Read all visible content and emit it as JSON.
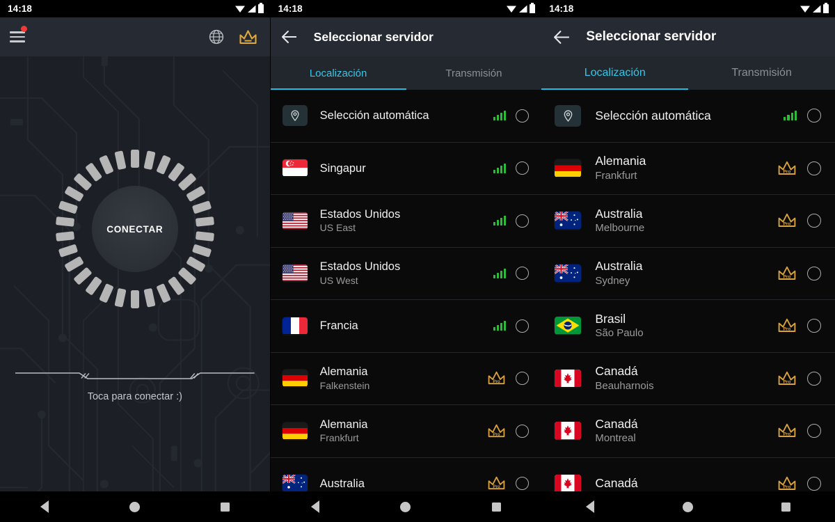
{
  "meta": {
    "accent_cyan": "#19c0e3",
    "accent_gold": "#e0a93b",
    "signal_green": "#2fbb3a",
    "alert_red": "#f03b35"
  },
  "status_bar": {
    "time": "14:18",
    "wifi_icon": "wifi-icon",
    "signal_icon": "cell-signal-icon",
    "battery_icon": "battery-icon"
  },
  "nav_bar": {
    "back": "back-triangle-icon",
    "home": "home-circle-icon",
    "recents": "recents-square-icon"
  },
  "panel_home": {
    "toolbar": {
      "menu_icon": "hamburger-menu-icon",
      "badge": "notification-dot",
      "globe_icon": "globe-icon",
      "crown_icon": "crown-icon"
    },
    "connect_button": {
      "label": "CONECTAR"
    },
    "hint": "Toca para conectar :)"
  },
  "panel_servers_narrow": {
    "toolbar": {
      "back_icon": "back-arrow-icon",
      "title": "Seleccionar servidor"
    },
    "tabs": [
      {
        "label": "Localización",
        "active": true
      },
      {
        "label": "Transmisión",
        "active": false
      }
    ],
    "rows": [
      {
        "country": "Selección automática",
        "city": "",
        "flag": "auto-location-pin",
        "badge": "signal",
        "selected": false
      },
      {
        "country": "Singapur",
        "city": "",
        "flag": "sg",
        "badge": "signal",
        "selected": false
      },
      {
        "country": "Estados Unidos",
        "city": "US East",
        "flag": "us",
        "badge": "signal",
        "selected": false
      },
      {
        "country": "Estados Unidos",
        "city": "US West",
        "flag": "us",
        "badge": "signal",
        "selected": false
      },
      {
        "country": "Francia",
        "city": "",
        "flag": "fr",
        "badge": "signal",
        "selected": false
      },
      {
        "country": "Alemania",
        "city": "Falkenstein",
        "flag": "de",
        "badge": "pro",
        "selected": false
      },
      {
        "country": "Alemania",
        "city": "Frankfurt",
        "flag": "de",
        "badge": "pro",
        "selected": false
      },
      {
        "country": "Australia",
        "city": "",
        "flag": "au",
        "badge": "pro",
        "selected": false
      }
    ]
  },
  "panel_servers_wide": {
    "toolbar": {
      "back_icon": "back-arrow-icon",
      "title": "Seleccionar servidor"
    },
    "tabs": [
      {
        "label": "Localización",
        "active": true
      },
      {
        "label": "Transmisión",
        "active": false
      }
    ],
    "rows": [
      {
        "country": "Selección automática",
        "city": "",
        "flag": "auto-location-pin",
        "badge": "signal",
        "selected": false
      },
      {
        "country": "Alemania",
        "city": "Frankfurt",
        "flag": "de",
        "badge": "pro",
        "selected": false
      },
      {
        "country": "Australia",
        "city": "Melbourne",
        "flag": "au",
        "badge": "pro",
        "selected": false
      },
      {
        "country": "Australia",
        "city": "Sydney",
        "flag": "au",
        "badge": "pro",
        "selected": false
      },
      {
        "country": "Brasil",
        "city": "São Paulo",
        "flag": "br",
        "badge": "pro",
        "selected": false
      },
      {
        "country": "Canadá",
        "city": "Beauharnois",
        "flag": "ca",
        "badge": "pro",
        "selected": false
      },
      {
        "country": "Canadá",
        "city": "Montreal",
        "flag": "ca",
        "badge": "pro",
        "selected": false
      },
      {
        "country": "Canadá",
        "city": "",
        "flag": "ca",
        "badge": "pro",
        "selected": false
      }
    ]
  },
  "badges": {
    "pro_label": "Pro"
  }
}
